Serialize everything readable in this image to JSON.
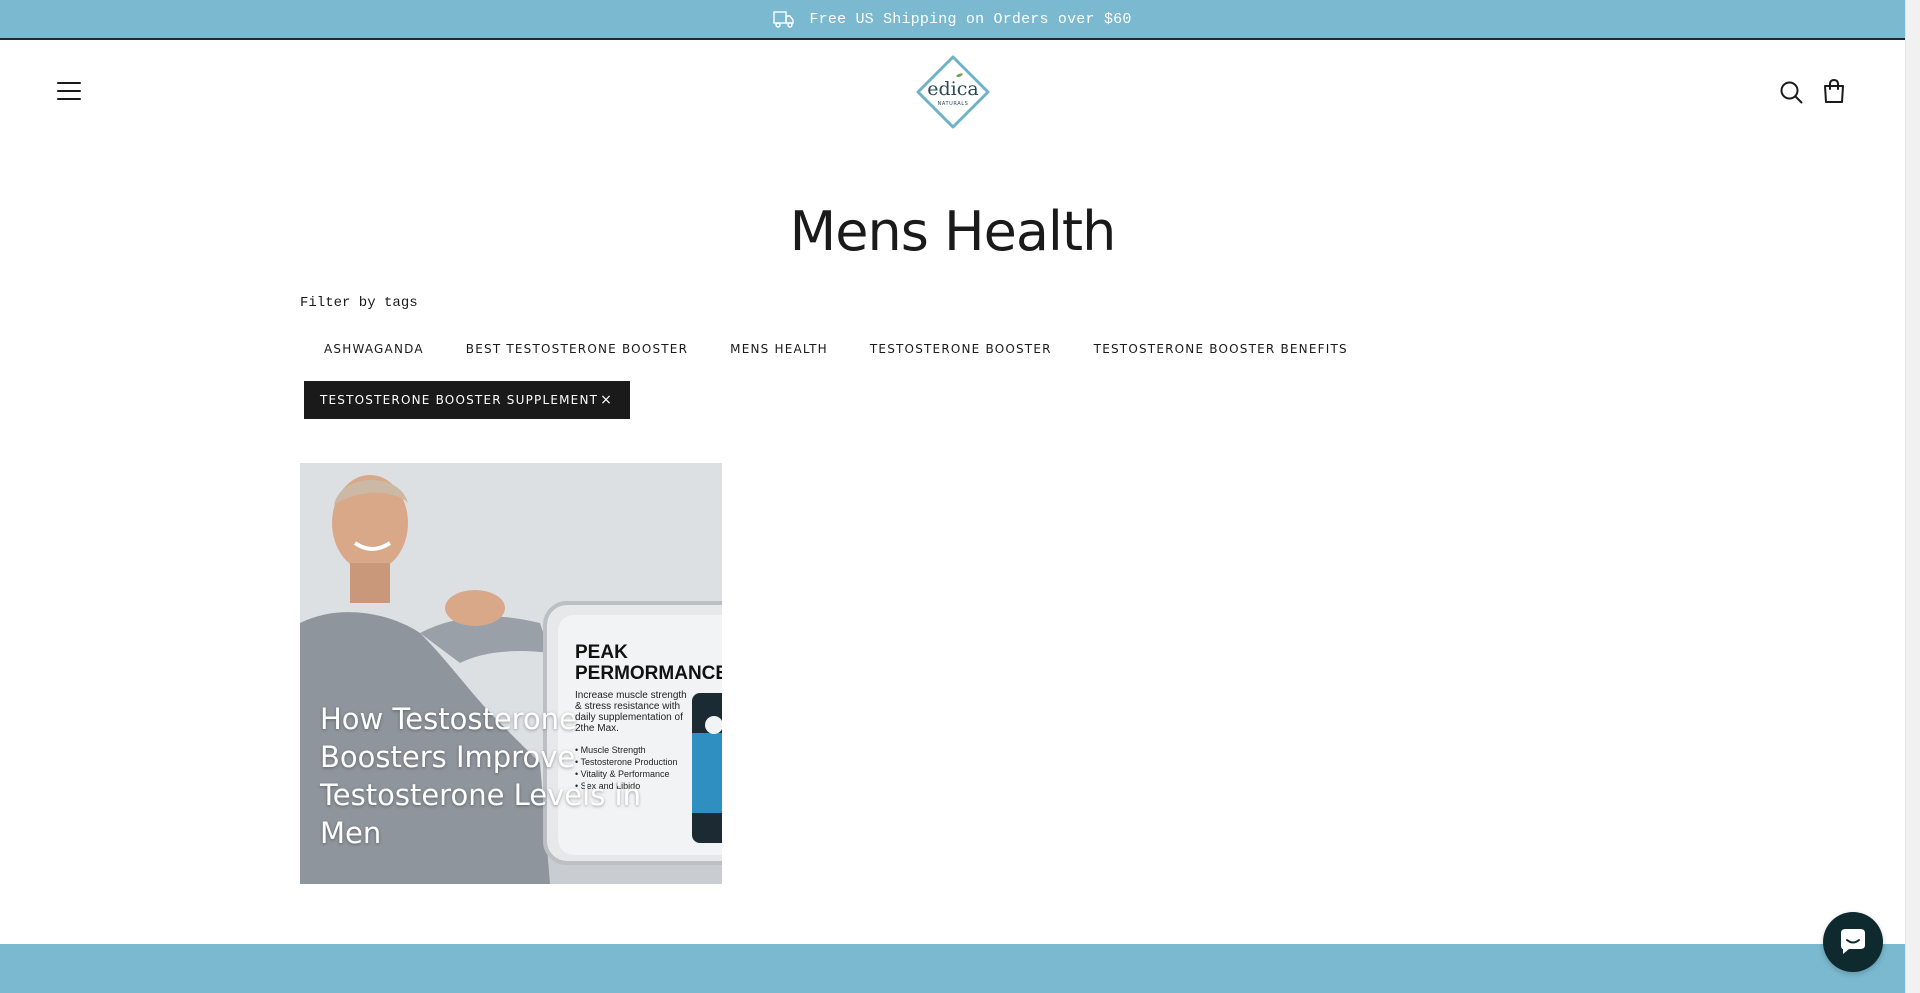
{
  "announcement": {
    "text": "Free US Shipping on Orders over $60",
    "icon": "truck-icon"
  },
  "header": {
    "menu_icon": "hamburger-menu-icon",
    "logo_text": "edica",
    "logo_subtext": "NATURALS",
    "search_icon": "search-icon",
    "cart_icon": "shopping-bag-icon"
  },
  "page": {
    "title": "Mens Health"
  },
  "filters": {
    "label": "Filter by tags",
    "tags": [
      "ASHWAGANDA",
      "BEST TESTOSTERONE BOOSTER",
      "MENS HEALTH",
      "TESTOSTERONE BOOSTER",
      "TESTOSTERONE BOOSTER BENEFITS"
    ],
    "active_tag": "TESTOSTERONE BOOSTER SUPPLEMENT",
    "remove_symbol": "×"
  },
  "articles": [
    {
      "title": "How Testosterone Boosters Improve Testosterone Levels in Men",
      "image": {
        "headline": "PEAK PERMORMANCE",
        "headline_line1": "PEAK",
        "headline_line2": "PERMORMANCE",
        "body_lines": [
          "Increase muscle strength",
          "& stress resistance with",
          "daily supplementation of",
          "2the Max."
        ],
        "bullets": [
          "• Muscle Strength",
          "• Testosterone Production",
          "• Vitality & Performance",
          "• Sex and Libido"
        ]
      }
    }
  ],
  "chat": {
    "icon": "chat-bubble-icon"
  },
  "colors": {
    "accent": "#7ab9cf",
    "dark": "#1a1a1a",
    "chat": "#0f2a2f"
  }
}
